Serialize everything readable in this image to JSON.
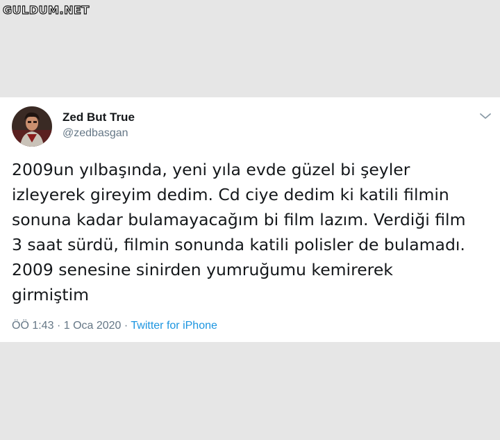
{
  "watermark": "GULDUM.NET",
  "tweet": {
    "display_name": "Zed But True",
    "handle": "@zedbasgan",
    "text": "2009un yılbaşında, yeni yıla evde güzel bi şeyler\nizleyerek gireyim dedim. Cd ciye dedim ki katili filmin\nsonuna kadar bulamayacağım bi film lazım. Verdiği film\n3 saat sürdü, filmin sonunda katili polisler de bulamadı.\n2009 senesine sinirden yumruğumu kemirerek\ngirmiştim",
    "time": "ÖÖ 1:43",
    "separator": "·",
    "date": "1 Oca 2020",
    "source": "Twitter for iPhone"
  },
  "colors": {
    "background": "#e6e6e6",
    "card": "#ffffff",
    "text": "#14171a",
    "secondary": "#657786",
    "link": "#1b95e0"
  },
  "icons": {
    "menu": "chevron-down-icon",
    "avatar": "avatar"
  }
}
